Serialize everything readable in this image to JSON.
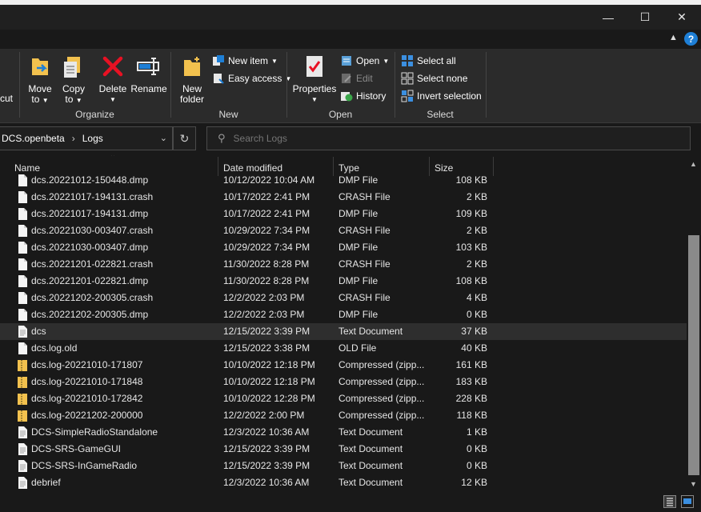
{
  "window": {
    "minimize": "—",
    "maximize": "☐",
    "close": "✕"
  },
  "ribbon": {
    "cut_partial": "cut",
    "organize": {
      "label": "Organize",
      "move_to": [
        "Move",
        "to"
      ],
      "copy_to": [
        "Copy",
        "to"
      ],
      "delete": "Delete",
      "rename": "Rename"
    },
    "new": {
      "label": "New",
      "new_folder": [
        "New",
        "folder"
      ],
      "new_item": "New item",
      "easy_access": "Easy access"
    },
    "open": {
      "label": "Open",
      "properties": "Properties",
      "open": "Open",
      "edit": "Edit",
      "history": "History"
    },
    "select": {
      "label": "Select",
      "select_all": "Select all",
      "select_none": "Select none",
      "invert": "Invert selection"
    }
  },
  "address": {
    "parent": "DCS.openbeta",
    "current": "Logs"
  },
  "search": {
    "placeholder": "Search Logs"
  },
  "columns": {
    "name": "Name",
    "date": "Date modified",
    "type": "Type",
    "size": "Size"
  },
  "files": [
    {
      "name": "dcs.20221012-150448.dmp",
      "date": "10/12/2022 10:04 AM",
      "type": "DMP File",
      "size": "108 KB",
      "icon": "file-icon"
    },
    {
      "name": "dcs.20221017-194131.crash",
      "date": "10/17/2022 2:41 PM",
      "type": "CRASH File",
      "size": "2 KB",
      "icon": "file-icon"
    },
    {
      "name": "dcs.20221017-194131.dmp",
      "date": "10/17/2022 2:41 PM",
      "type": "DMP File",
      "size": "109 KB",
      "icon": "file-icon"
    },
    {
      "name": "dcs.20221030-003407.crash",
      "date": "10/29/2022 7:34 PM",
      "type": "CRASH File",
      "size": "2 KB",
      "icon": "file-icon"
    },
    {
      "name": "dcs.20221030-003407.dmp",
      "date": "10/29/2022 7:34 PM",
      "type": "DMP File",
      "size": "103 KB",
      "icon": "file-icon"
    },
    {
      "name": "dcs.20221201-022821.crash",
      "date": "11/30/2022 8:28 PM",
      "type": "CRASH File",
      "size": "2 KB",
      "icon": "file-icon"
    },
    {
      "name": "dcs.20221201-022821.dmp",
      "date": "11/30/2022 8:28 PM",
      "type": "DMP File",
      "size": "108 KB",
      "icon": "file-icon"
    },
    {
      "name": "dcs.20221202-200305.crash",
      "date": "12/2/2022 2:03 PM",
      "type": "CRASH File",
      "size": "4 KB",
      "icon": "file-icon"
    },
    {
      "name": "dcs.20221202-200305.dmp",
      "date": "12/2/2022 2:03 PM",
      "type": "DMP File",
      "size": "0 KB",
      "icon": "file-icon"
    },
    {
      "name": "dcs",
      "date": "12/15/2022 3:39 PM",
      "type": "Text Document",
      "size": "37 KB",
      "icon": "text-file-icon",
      "selected": true
    },
    {
      "name": "dcs.log.old",
      "date": "12/15/2022 3:38 PM",
      "type": "OLD File",
      "size": "40 KB",
      "icon": "file-icon"
    },
    {
      "name": "dcs.log-20221010-171807",
      "date": "10/10/2022 12:18 PM",
      "type": "Compressed (zipp...",
      "size": "161 KB",
      "icon": "zip-folder-icon"
    },
    {
      "name": "dcs.log-20221010-171848",
      "date": "10/10/2022 12:18 PM",
      "type": "Compressed (zipp...",
      "size": "183 KB",
      "icon": "zip-folder-icon"
    },
    {
      "name": "dcs.log-20221010-172842",
      "date": "10/10/2022 12:28 PM",
      "type": "Compressed (zipp...",
      "size": "228 KB",
      "icon": "zip-folder-icon"
    },
    {
      "name": "dcs.log-20221202-200000",
      "date": "12/2/2022 2:00 PM",
      "type": "Compressed (zipp...",
      "size": "118 KB",
      "icon": "zip-folder-icon"
    },
    {
      "name": "DCS-SimpleRadioStandalone",
      "date": "12/3/2022 10:36 AM",
      "type": "Text Document",
      "size": "1 KB",
      "icon": "text-file-icon"
    },
    {
      "name": "DCS-SRS-GameGUI",
      "date": "12/15/2022 3:39 PM",
      "type": "Text Document",
      "size": "0 KB",
      "icon": "text-file-icon"
    },
    {
      "name": "DCS-SRS-InGameRadio",
      "date": "12/15/2022 3:39 PM",
      "type": "Text Document",
      "size": "0 KB",
      "icon": "text-file-icon"
    },
    {
      "name": "debrief",
      "date": "12/3/2022 10:36 AM",
      "type": "Text Document",
      "size": "12 KB",
      "icon": "text-file-icon"
    }
  ],
  "colors": {
    "background": "#191919",
    "ribbon": "#2b2b2b",
    "accent": "#1e7fd6",
    "delete_red": "#e81123",
    "folder_yellow": "#f2c14e"
  }
}
